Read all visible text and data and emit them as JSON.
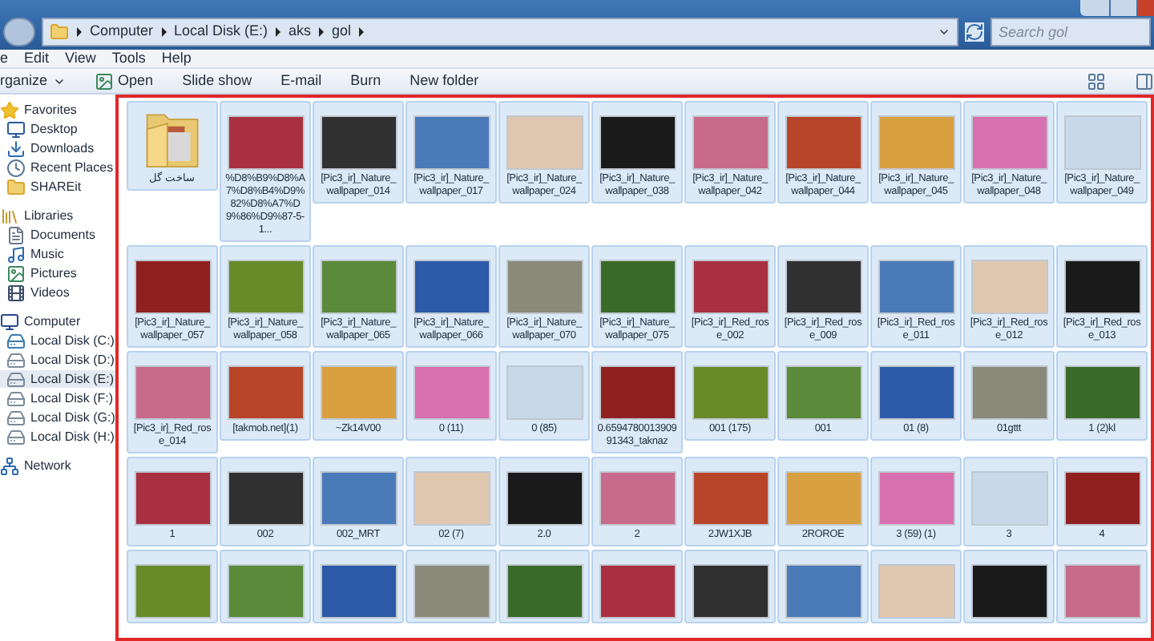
{
  "address_bar": {
    "crumbs": [
      "Computer",
      "Local Disk (E:)",
      "aks",
      "gol"
    ]
  },
  "search": {
    "placeholder": "Search gol"
  },
  "menu_bar": [
    "e",
    "Edit",
    "View",
    "Tools",
    "Help"
  ],
  "toolbar": [
    {
      "label": "rganize",
      "kind": "dropdown"
    },
    {
      "label": "Open",
      "kind": "icon"
    },
    {
      "label": "Slide show",
      "kind": "plain"
    },
    {
      "label": "E-mail",
      "kind": "plain"
    },
    {
      "label": "Burn",
      "kind": "plain"
    },
    {
      "label": "New folder",
      "kind": "plain"
    }
  ],
  "sidebar": [
    {
      "label": "Favorites",
      "kind": "favorites",
      "children": [
        {
          "label": "Desktop",
          "kind": "desktop",
          "selected": false
        },
        {
          "label": "Downloads",
          "kind": "downloads",
          "selected": false
        },
        {
          "label": "Recent Places",
          "kind": "recent",
          "selected": false
        },
        {
          "label": "SHAREit",
          "kind": "folder",
          "selected": false
        }
      ]
    },
    {
      "label": "Libraries",
      "kind": "libraries",
      "children": [
        {
          "label": "Documents",
          "kind": "documents",
          "selected": false
        },
        {
          "label": "Music",
          "kind": "music",
          "selected": false
        },
        {
          "label": "Pictures",
          "kind": "pictures",
          "selected": false
        },
        {
          "label": "Videos",
          "kind": "videos",
          "selected": false
        }
      ]
    },
    {
      "label": "Computer",
      "kind": "computer",
      "children": [
        {
          "label": "Local Disk (C:)",
          "kind": "system-drive",
          "selected": false
        },
        {
          "label": "Local Disk (D:)",
          "kind": "drive",
          "selected": false
        },
        {
          "label": "Local Disk (E:)",
          "kind": "drive",
          "selected": true
        },
        {
          "label": "Local Disk (F:)",
          "kind": "drive",
          "selected": false
        },
        {
          "label": "Local Disk (G:)",
          "kind": "drive",
          "selected": false
        },
        {
          "label": "Local Disk (H:)",
          "kind": "drive",
          "selected": false
        }
      ]
    },
    {
      "label": "Network",
      "kind": "network"
    }
  ],
  "files": [
    {
      "name": "ساخت گل",
      "kind": "folder",
      "selected": true
    },
    {
      "name": "%D8%B9%D8%A7%D8%B4%D9%82%D8%A7%D9%86%D9%87-5-1...",
      "kind": "photo",
      "selected": true
    },
    {
      "name": "[Pic3_ir]_Nature_wallpaper_014",
      "kind": "photo",
      "selected": true
    },
    {
      "name": "[Pic3_ir]_Nature_wallpaper_017",
      "kind": "photo",
      "selected": true
    },
    {
      "name": "[Pic3_ir]_Nature_wallpaper_024",
      "kind": "photo",
      "selected": true
    },
    {
      "name": "[Pic3_ir]_Nature_wallpaper_038",
      "kind": "photo",
      "selected": true
    },
    {
      "name": "[Pic3_ir]_Nature_wallpaper_042",
      "kind": "photo",
      "selected": true
    },
    {
      "name": "[Pic3_ir]_Nature_wallpaper_044",
      "kind": "photo",
      "selected": true
    },
    {
      "name": "[Pic3_ir]_Nature_wallpaper_045",
      "kind": "photo",
      "selected": true
    },
    {
      "name": "[Pic3_ir]_Nature_wallpaper_048",
      "kind": "photo",
      "selected": true
    },
    {
      "name": "[Pic3_ir]_Nature_wallpaper_049",
      "kind": "photo",
      "selected": true
    },
    {
      "name": "[Pic3_ir]_Nature_wallpaper_057",
      "kind": "photo",
      "selected": true
    },
    {
      "name": "[Pic3_ir]_Nature_wallpaper_058",
      "kind": "photo",
      "selected": true
    },
    {
      "name": "[Pic3_ir]_Nature_wallpaper_065",
      "kind": "photo",
      "selected": true
    },
    {
      "name": "[Pic3_ir]_Nature_wallpaper_066",
      "kind": "photo",
      "selected": true
    },
    {
      "name": "[Pic3_ir]_Nature_wallpaper_070",
      "kind": "photo",
      "selected": true
    },
    {
      "name": "[Pic3_ir]_Nature_wallpaper_075",
      "kind": "photo",
      "selected": true
    },
    {
      "name": "[Pic3_ir]_Red_rose_002",
      "kind": "photo",
      "selected": true
    },
    {
      "name": "[Pic3_ir]_Red_rose_009",
      "kind": "photo",
      "selected": true
    },
    {
      "name": "[Pic3_ir]_Red_rose_011",
      "kind": "photo",
      "selected": true
    },
    {
      "name": "[Pic3_ir]_Red_rose_012",
      "kind": "photo",
      "selected": true
    },
    {
      "name": "[Pic3_ir]_Red_rose_013",
      "kind": "photo",
      "selected": true
    },
    {
      "name": "[Pic3_ir]_Red_rose_014",
      "kind": "photo",
      "selected": true
    },
    {
      "name": "[takmob.net](1)",
      "kind": "photo",
      "selected": true
    },
    {
      "name": "~Zk14V00",
      "kind": "photo",
      "selected": true
    },
    {
      "name": "0 (11)",
      "kind": "photo",
      "selected": true
    },
    {
      "name": "0 (85)",
      "kind": "photo",
      "selected": true
    },
    {
      "name": "0.659478001390991343_taknaz",
      "kind": "photo",
      "selected": true
    },
    {
      "name": "001 (175)",
      "kind": "photo",
      "selected": true
    },
    {
      "name": "001",
      "kind": "photo",
      "selected": true
    },
    {
      "name": "01 (8)",
      "kind": "photo",
      "selected": true
    },
    {
      "name": "01gttt",
      "kind": "photo",
      "selected": true
    },
    {
      "name": "1 (2)kl",
      "kind": "photo",
      "selected": true
    },
    {
      "name": "1",
      "kind": "photo",
      "selected": true
    },
    {
      "name": "002",
      "kind": "photo",
      "selected": true
    },
    {
      "name": "002_MRT",
      "kind": "photo",
      "selected": true
    },
    {
      "name": "02 (7)",
      "kind": "photo",
      "selected": true
    },
    {
      "name": "2.0",
      "kind": "photo",
      "selected": true
    },
    {
      "name": "2",
      "kind": "photo",
      "selected": true
    },
    {
      "name": "2JW1XJB",
      "kind": "photo",
      "selected": true
    },
    {
      "name": "2ROROE",
      "kind": "photo",
      "selected": true
    },
    {
      "name": "3 (59) (1)",
      "kind": "photo",
      "selected": true
    },
    {
      "name": "3",
      "kind": "photo",
      "selected": true
    },
    {
      "name": "4",
      "kind": "photo",
      "selected": true
    },
    {
      "kind": "photo",
      "selected": true
    },
    {
      "kind": "photo",
      "selected": true
    },
    {
      "kind": "photo",
      "selected": true
    },
    {
      "kind": "photo",
      "selected": true
    },
    {
      "kind": "photo",
      "selected": true
    },
    {
      "kind": "photo",
      "selected": true
    },
    {
      "kind": "photo",
      "selected": true
    },
    {
      "kind": "photo",
      "selected": true
    },
    {
      "kind": "photo",
      "selected": true
    },
    {
      "kind": "photo",
      "selected": true
    },
    {
      "kind": "photo",
      "selected": true
    }
  ]
}
